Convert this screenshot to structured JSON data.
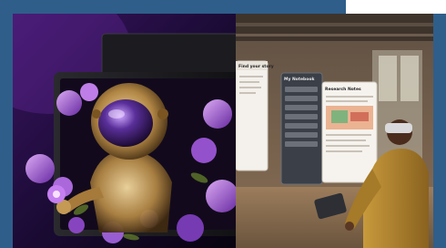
{
  "left_image": {
    "subject": "astronaut-tablet-illustration",
    "colors": {
      "background": "#1b0b35",
      "accent": "#a04bd8"
    }
  },
  "right_image": {
    "subject": "mixed-reality-headset-workspace",
    "window_left": {
      "title": "Find your story"
    },
    "window_middle": {
      "title": "My Notebook"
    },
    "window_right": {
      "title": "Research Notes"
    },
    "colors": {
      "wall": "#6e5a48",
      "jacket": "#b3862f"
    }
  }
}
